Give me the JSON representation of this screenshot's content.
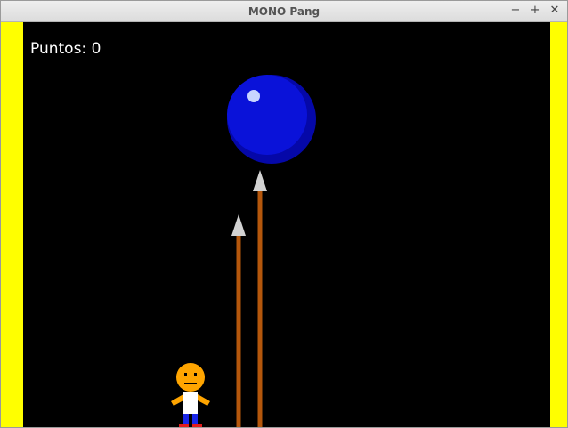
{
  "window": {
    "title": "MONO Pang",
    "controls": {
      "minimize": "−",
      "maximize": "+",
      "close": "✕"
    }
  },
  "hud": {
    "score_label": "Puntos:",
    "score_value": "0"
  },
  "colors": {
    "wall": "#ffff00",
    "background": "#000000",
    "ball": "#0a12d9",
    "spear_shaft": "#b5570c",
    "spear_tip": "#d2d2d2",
    "player_head": "#ffa500"
  }
}
